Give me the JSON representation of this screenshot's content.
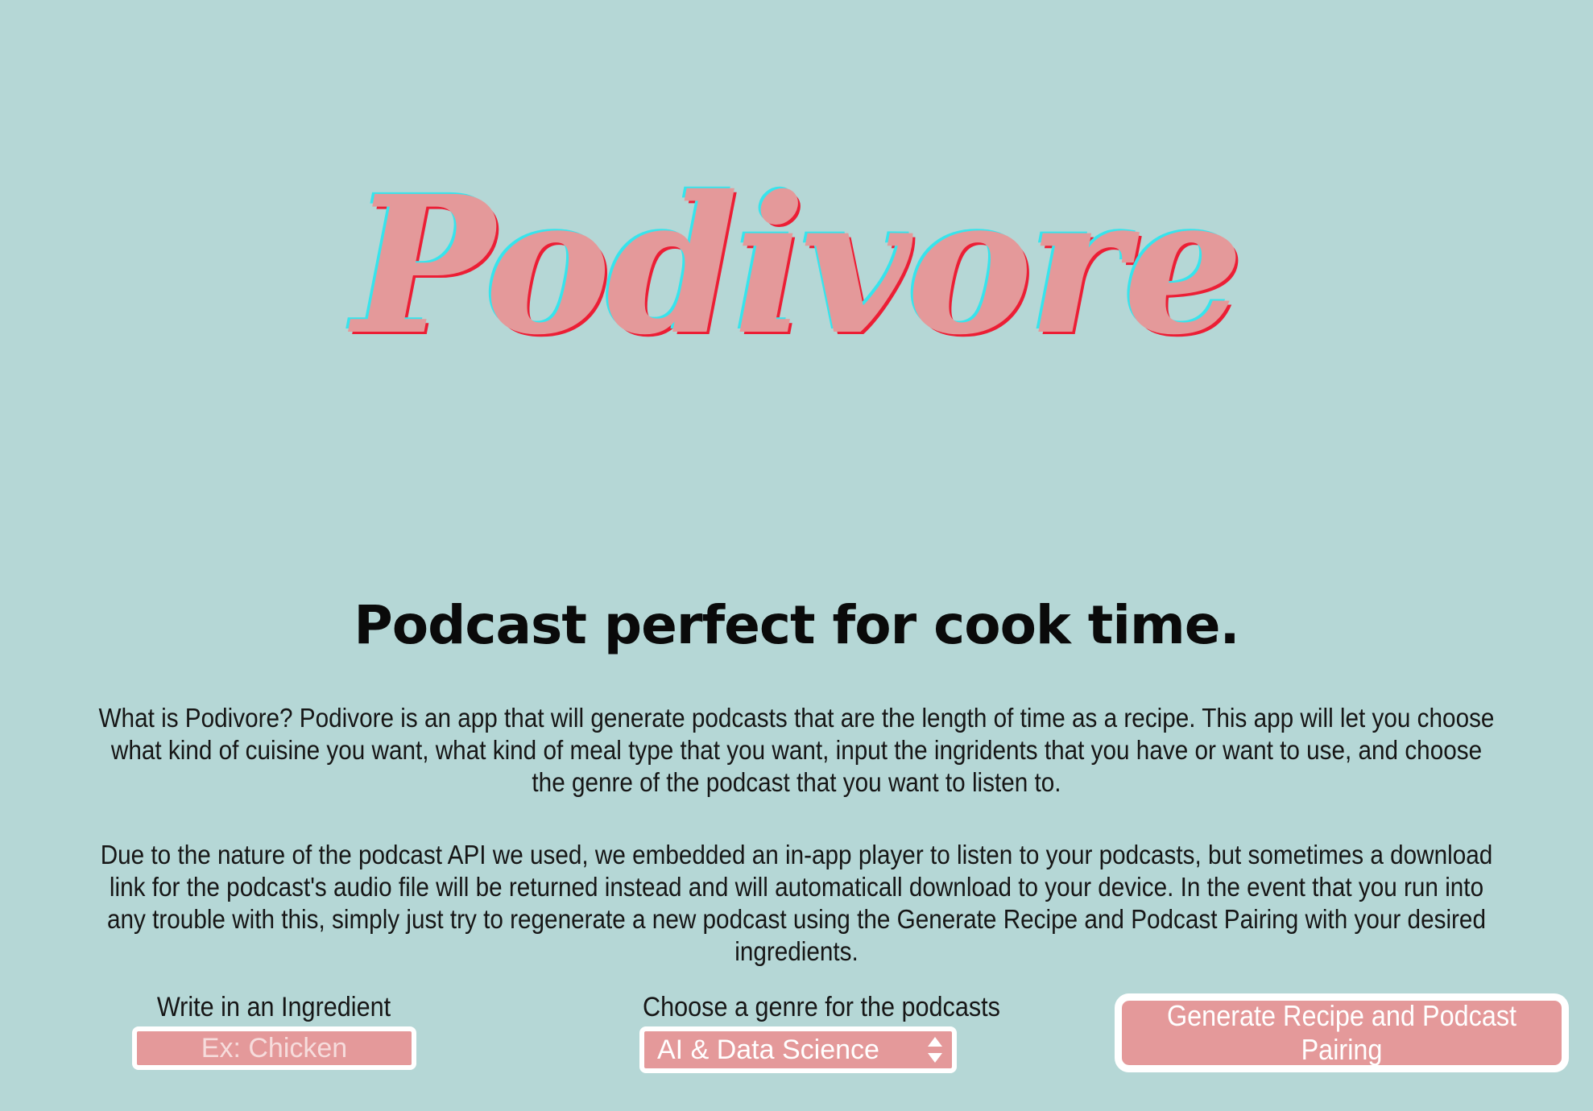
{
  "app": {
    "logo_text": "Podivore"
  },
  "hero": {
    "headline": "Podcast perfect for cook time."
  },
  "description": {
    "paragraph_1": "What is Podivore? Podivore is an app that will generate podcasts that are the length of time as a recipe. This app will let you choose what kind of cuisine you want, what kind of meal type that you want, input the ingridents that you have or want to use, and choose the genre of the podcast that you want to listen to.",
    "paragraph_2": "Due to the nature of the podcast API we used, we embedded an in-app player to listen to your podcasts, but sometimes a download link for the podcast's audio file will be returned instead and will automaticall download to your device. In the event that you run into any trouble with this, simply just try to regenerate a new podcast using the Generate Recipe and Podcast Pairing with your desired ingredients."
  },
  "form": {
    "ingredient_label": "Write in an Ingredient",
    "ingredient_value": "",
    "ingredient_placeholder": "Ex: Chicken",
    "genre_label": "Choose a genre for the podcasts",
    "genre_selected": "AI & Data Science",
    "generate_button_label": "Generate Recipe and Podcast Pairing"
  },
  "colors": {
    "background": "#b5d7d6",
    "accent_pink": "#e4999a",
    "logo_shadow_cyan": "#37e4ec",
    "logo_shadow_red": "#ec1e35",
    "control_border": "#ffffff"
  },
  "icons": {
    "select_arrows": "up-down-chevron-icon"
  }
}
